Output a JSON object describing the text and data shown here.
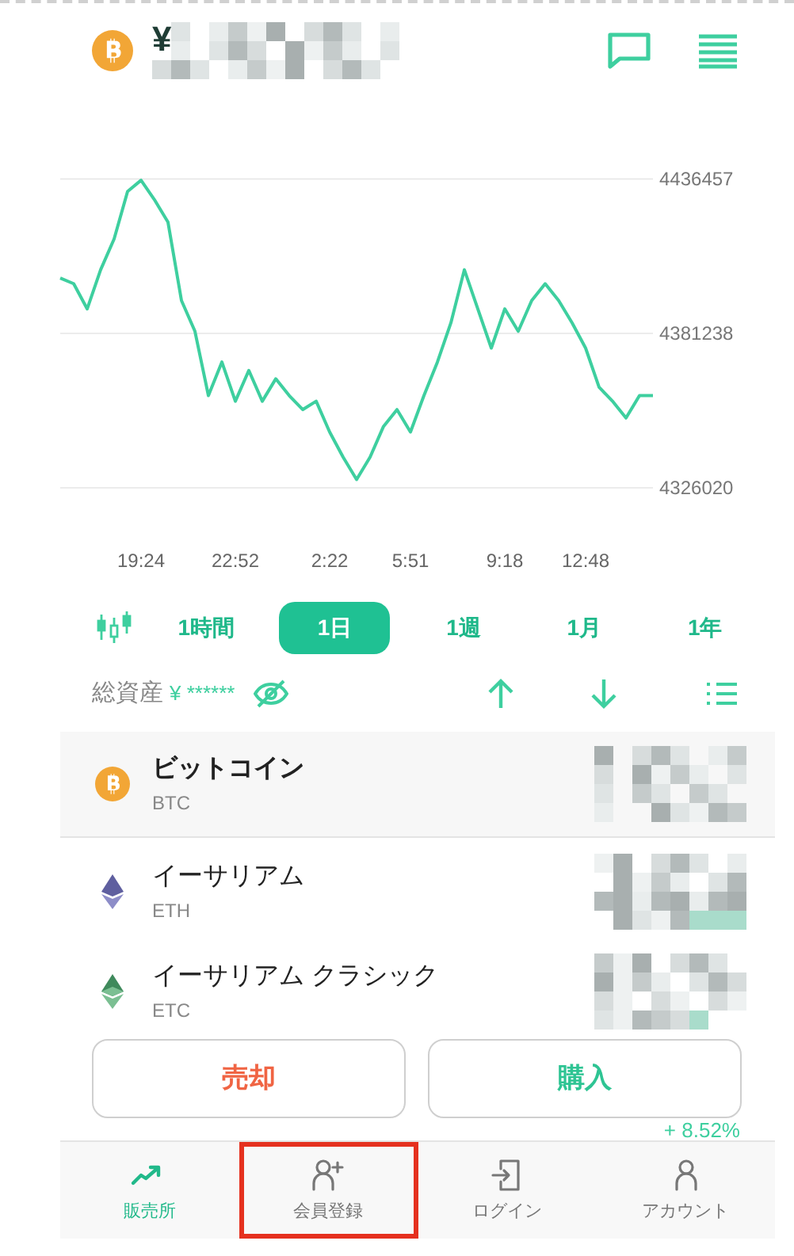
{
  "header": {
    "currency_symbol": "¥"
  },
  "chart": {
    "chart_data": {
      "type": "line",
      "categories": [
        null,
        null,
        null,
        null,
        null,
        null,
        "19:24",
        null,
        null,
        null,
        null,
        null,
        null,
        "22:52",
        null,
        null,
        null,
        null,
        null,
        null,
        "2:22",
        null,
        null,
        null,
        null,
        null,
        "5:51",
        null,
        null,
        null,
        null,
        null,
        null,
        "9:18",
        null,
        null,
        null,
        null,
        null,
        "12:48",
        null,
        null,
        null,
        null,
        null
      ],
      "series": [
        {
          "color": "#3ecf9f",
          "values": [
            4401000,
            4399000,
            4390000,
            4404000,
            4415000,
            4432000,
            4436000,
            4429000,
            4421000,
            4393000,
            4382000,
            4359000,
            4371000,
            4357000,
            4368000,
            4357000,
            4365000,
            4359000,
            4354000,
            4357000,
            4346000,
            4337000,
            4329000,
            4337000,
            4348000,
            4354000,
            4346000,
            4359000,
            4371000,
            4385000,
            4404000,
            4390000,
            4376000,
            4390000,
            4382000,
            4393000,
            4399000,
            4393000,
            4385000,
            4376000,
            4362000,
            4357000,
            4351000,
            4359000,
            4359000
          ]
        }
      ],
      "grid": true,
      "ylim": [
        4326020,
        4436457
      ],
      "yticks": [
        4326020,
        4381238,
        4436457
      ]
    }
  },
  "timeframes": [
    {
      "label": "1時間",
      "selected": false
    },
    {
      "label": "1日",
      "selected": true
    },
    {
      "label": "1週",
      "selected": false
    },
    {
      "label": "1月",
      "selected": false
    },
    {
      "label": "1年",
      "selected": false
    }
  ],
  "summary": {
    "label": "総資産",
    "value": "¥ ******"
  },
  "assets": [
    {
      "name": "ビットコイン",
      "symbol": "BTC",
      "selected": true
    },
    {
      "name": "イーサリアム",
      "symbol": "ETH",
      "selected": false
    },
    {
      "name": "イーサリアム クラシック",
      "symbol": "ETC",
      "selected": false
    }
  ],
  "partial_change": "+ 8.52%",
  "actions": [
    {
      "label": "売却",
      "kind": "sell"
    },
    {
      "label": "購入",
      "kind": "buy"
    }
  ],
  "nav": [
    {
      "label": "販売所",
      "selected": true,
      "highlighted": false
    },
    {
      "label": "会員登録",
      "selected": false,
      "highlighted": true
    },
    {
      "label": "ログイン",
      "selected": false,
      "highlighted": false
    },
    {
      "label": "アカウント",
      "selected": false,
      "highlighted": false
    }
  ]
}
